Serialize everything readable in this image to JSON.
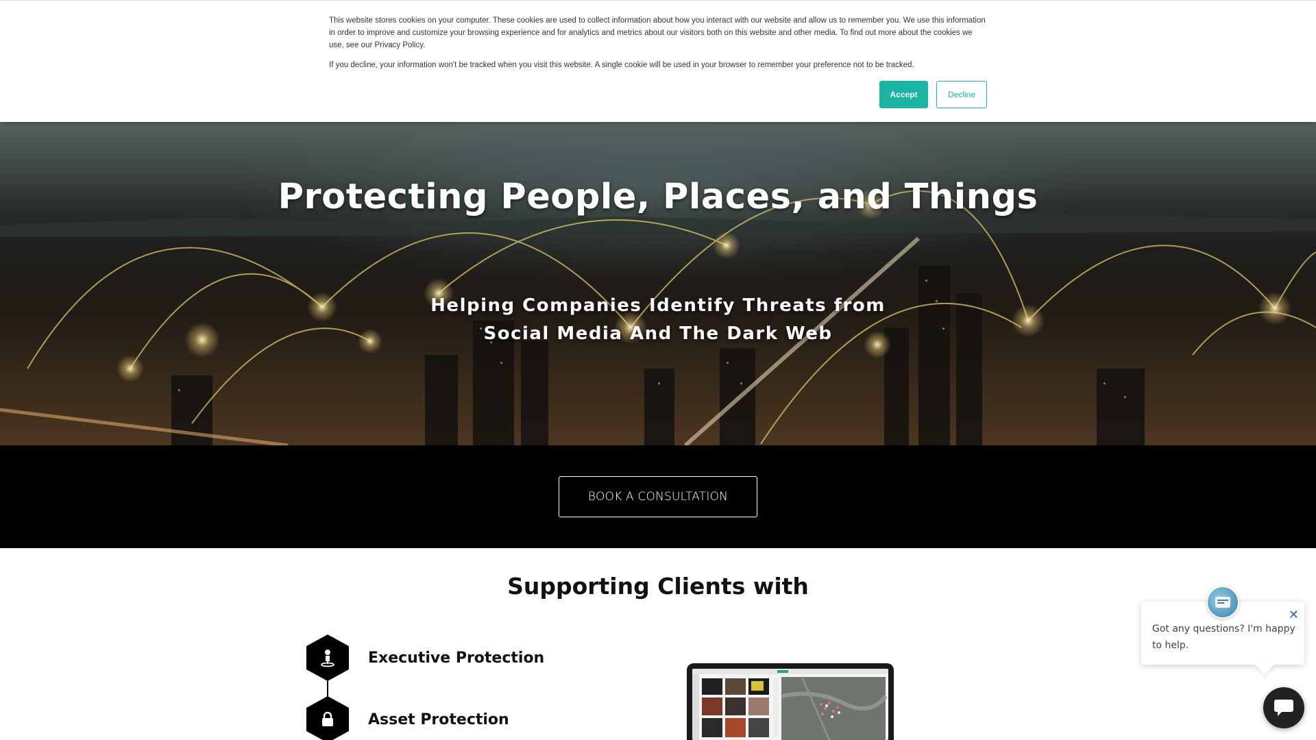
{
  "cookie_banner": {
    "text_1": "This website stores cookies on your computer. These cookies are used to collect information about how you interact with our website and allow us to remember you. We use this information in order to improve and customize your browsing experience and for analytics and metrics about our visitors both on this website and other media. To find out more about the cookies we use, see our Privacy Policy.",
    "text_2": "If you decline, your information won't be tracked when you visit this website. A single cookie will be used in your browser to remember your preference not to be tracked.",
    "accept_label": "Accept",
    "decline_label": "Decline",
    "accent_color": "#1bb3a2"
  },
  "hero": {
    "title": "Protecting People, Places, and Things",
    "subtitle_line_1": "Helping Companies Identify Threats from",
    "subtitle_line_2": "Social Media And The Dark Web"
  },
  "cta": {
    "button_label": "BOOK A CONSULTATION"
  },
  "services": {
    "title": "Supporting Clients with",
    "items": [
      {
        "label": "Executive Protection",
        "icon": "person-pin-icon"
      },
      {
        "label": "Asset Protection",
        "icon": "lock-icon"
      }
    ]
  },
  "chat": {
    "message": "Got any questions? I'm happy to help.",
    "close_icon": "close-icon",
    "launcher_icon": "chat-bubble-icon"
  }
}
